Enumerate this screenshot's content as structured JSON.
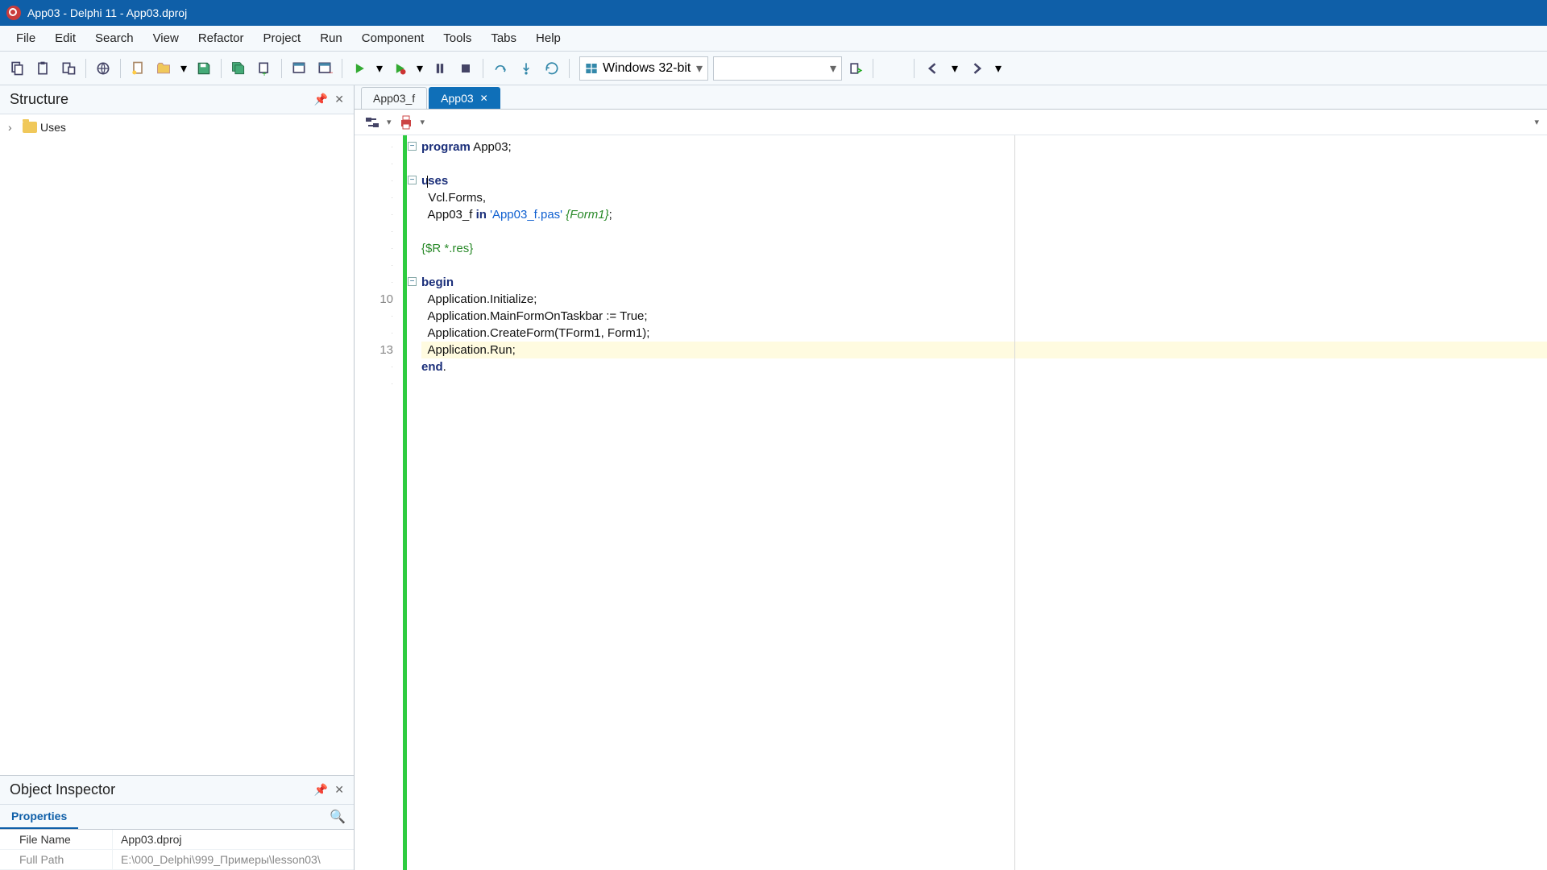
{
  "title": "App03 - Delphi 11 - App03.dproj",
  "menu": [
    "File",
    "Edit",
    "Search",
    "View",
    "Refactor",
    "Project",
    "Run",
    "Component",
    "Tools",
    "Tabs",
    "Help"
  ],
  "platform": "Windows 32-bit",
  "structure": {
    "title": "Structure",
    "nodes": [
      {
        "label": "Uses"
      }
    ]
  },
  "inspector": {
    "title": "Object Inspector",
    "tab": "Properties",
    "rows": [
      {
        "key": "File Name",
        "value": "App03.dproj",
        "dim": false
      },
      {
        "key": "Full Path",
        "value": "E:\\000_Delphi\\999_Примеры\\lesson03\\",
        "dim": true
      }
    ]
  },
  "tabs": [
    {
      "label": "App03_f",
      "active": false
    },
    {
      "label": "App03",
      "active": true
    }
  ],
  "code": {
    "visible_line_numbers": {
      "10": 10,
      "13": 13
    },
    "lines": [
      {
        "n": 1,
        "tokens": [
          [
            "kw",
            "program"
          ],
          [
            "",
            " App03;"
          ]
        ]
      },
      {
        "n": 2,
        "tokens": [
          [
            "",
            ""
          ]
        ]
      },
      {
        "n": 3,
        "tokens": [
          [
            "kw",
            "uses"
          ]
        ],
        "caret": true
      },
      {
        "n": 4,
        "tokens": [
          [
            "",
            "  Vcl.Forms,"
          ]
        ]
      },
      {
        "n": 5,
        "tokens": [
          [
            "",
            "  App03_f "
          ],
          [
            "kw",
            "in"
          ],
          [
            "",
            " "
          ],
          [
            "str",
            "'App03_f.pas'"
          ],
          [
            "",
            " "
          ],
          [
            "cmt",
            "{Form1}"
          ],
          [
            "",
            ";"
          ]
        ]
      },
      {
        "n": 6,
        "tokens": [
          [
            "",
            ""
          ]
        ]
      },
      {
        "n": 7,
        "tokens": [
          [
            "dir",
            "{$R *.res}"
          ]
        ]
      },
      {
        "n": 8,
        "tokens": [
          [
            "",
            ""
          ]
        ]
      },
      {
        "n": 9,
        "tokens": [
          [
            "kw",
            "begin"
          ]
        ]
      },
      {
        "n": 10,
        "tokens": [
          [
            "",
            "  Application.Initialize;"
          ]
        ]
      },
      {
        "n": 11,
        "tokens": [
          [
            "",
            "  Application.MainFormOnTaskbar := True;"
          ]
        ]
      },
      {
        "n": 12,
        "tokens": [
          [
            "",
            "  Application.CreateForm(TForm1, Form1);"
          ]
        ]
      },
      {
        "n": 13,
        "tokens": [
          [
            "",
            "  Application.Run;"
          ]
        ],
        "highlight": true
      },
      {
        "n": 14,
        "tokens": [
          [
            "kw",
            "end"
          ],
          [
            "",
            "."
          ]
        ]
      },
      {
        "n": 15,
        "tokens": [
          [
            "",
            ""
          ]
        ]
      }
    ],
    "fold_markers": [
      1,
      3,
      9
    ]
  }
}
